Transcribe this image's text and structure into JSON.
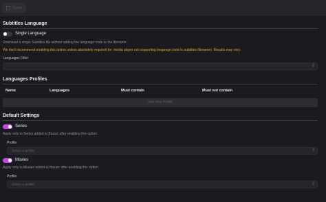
{
  "toolbar": {
    "save_label": "Save",
    "save_icon": "save-icon"
  },
  "subtitles_language": {
    "title": "Subtitles Language",
    "single_language_label": "Single Language",
    "single_language_hint": "Download a single Subtitles file without adding the language code to the filename.",
    "single_language_warning": "We don't recommend enabling this option unless absolutely required (ie: media player not supporting language code in subtitles filename). Results may vary.",
    "single_language_enabled": false,
    "languages_filter_label": "Languages Filter",
    "languages_filter_value": ""
  },
  "languages_profiles": {
    "title": "Languages Profiles",
    "columns": [
      "Name",
      "Languages",
      "Must contain",
      "Must not contain"
    ],
    "add_button_label": "Add New Profile"
  },
  "default_settings": {
    "title": "Default Settings",
    "series_label": "Series",
    "series_enabled": true,
    "series_hint": "Apply only to Series added to Bazarr after enabling this option.",
    "series_profile_label": "Profile",
    "series_profile_placeholder": "Select a profile",
    "movies_label": "Movies",
    "movies_enabled": true,
    "movies_hint": "Apply only to Movies added to Bazarr after enabling this option.",
    "movies_profile_label": "Profile",
    "movies_profile_placeholder": "Select a profile"
  },
  "colors": {
    "accent": "#be4bdb",
    "warning": "#e8a427",
    "background": "#1a1b1e"
  }
}
